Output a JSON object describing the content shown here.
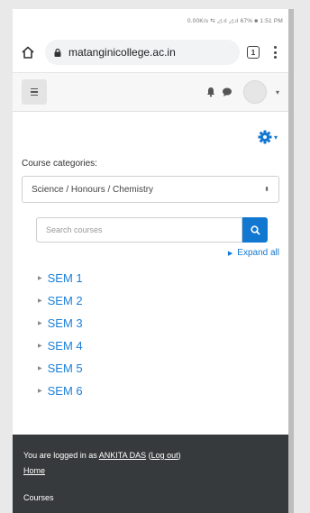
{
  "status_bar": {
    "text": "0.00K/s ⇆ ◿.ıl ◿.ıl 67% ■ 1:51 PM"
  },
  "browser": {
    "url": "matanginicollege.ac.in",
    "tabs_count": "1"
  },
  "navbar": {
    "caret": "▾"
  },
  "content": {
    "category_label": "Course categories:",
    "category_selected": "Science / Honours / Chemistry",
    "search_placeholder": "Search courses",
    "expand_all": "Expand all",
    "semesters": [
      "SEM 1",
      "SEM 2",
      "SEM 3",
      "SEM 4",
      "SEM 5",
      "SEM 6"
    ]
  },
  "footer": {
    "logged_prefix": "You are logged in as ",
    "user_name": "ANKITA DAS",
    "logout_label": "Log out",
    "home_label": "Home",
    "courses_label": "Courses"
  },
  "colors": {
    "accent": "#1177d1",
    "footer_bg": "#373a3c",
    "link": "#1a7fd8"
  }
}
